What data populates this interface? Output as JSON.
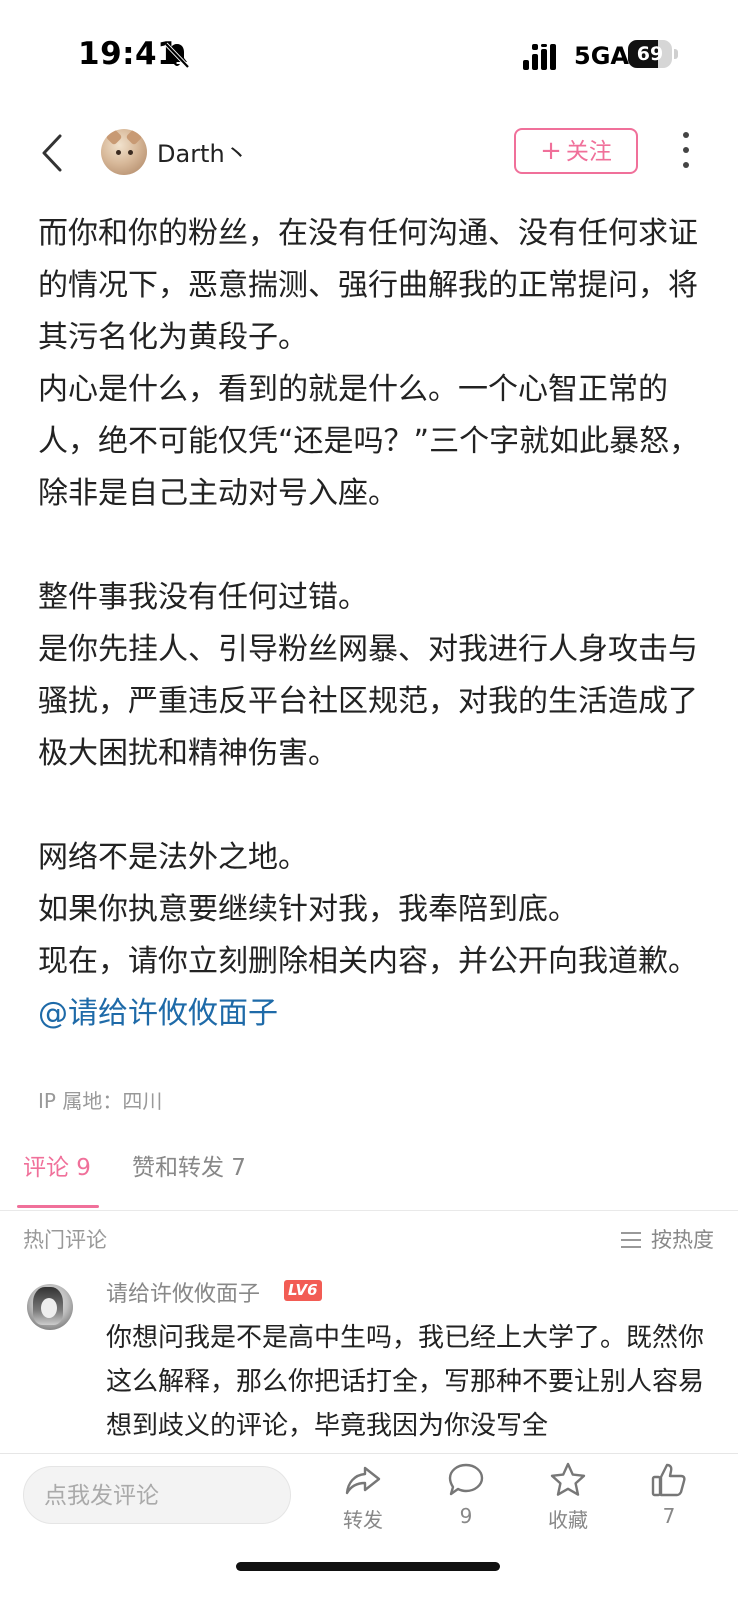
{
  "status_bar": {
    "time": "19:41",
    "network": "5GA",
    "battery": "69",
    "battery_level": 0.69
  },
  "header": {
    "username": "Darth丶",
    "follow_label": "关注",
    "follow_prefix": "+"
  },
  "article": {
    "paragraphs": [
      "而你和你的粉丝，在没有任何沟通、没有任何求证的情况下，恶意揣测、强行曲解我的正常提问，将其污名化为黄段子。",
      "内心是什么，看到的就是什么。一个心智正常的人，绝不可能仅凭“还是吗？”三个字就如此暴怒，除非是自己主动对号入座。",
      "整件事我没有任何过错。",
      "是你先挂人、引导粉丝网暴、对我进行人身攻击与骚扰，严重违反平台社区规范，对我的生活造成了极大困扰和精神伤害。",
      "网络不是法外之地。",
      "如果你执意要继续针对我，我奉陪到底。",
      "现在，请你立刻删除相关内容，并公开向我道歉。"
    ],
    "mention": "@请给许攸攸面子",
    "ip_location": "IP 属地：四川"
  },
  "tabs": {
    "comments": "评论 9",
    "likes_reposts": "赞和转发 7"
  },
  "comments_section": {
    "title": "热门评论",
    "sort_label": "按热度",
    "items": [
      {
        "author": "请给许攸攸面子",
        "level": "LV6",
        "text": "你想问我是不是高中生吗，我已经上大学了。既然你这么解释，那么你把话打全，写那种不要让别人容易想到歧义的评论，毕竟我因为你没写全"
      }
    ]
  },
  "bottom_bar": {
    "input_placeholder": "点我发评论",
    "share_label": "转发",
    "comment_count": "9",
    "favorite_label": "收藏",
    "like_count": "7"
  },
  "colors": {
    "accent": "#f0709a",
    "mention": "#1e6aa8",
    "level_badge": "#f25c54"
  },
  "icons": [
    "mute-bell-icon",
    "signal-icon",
    "battery-icon",
    "back-arrow-icon",
    "more-icon",
    "sort-icon",
    "share-icon",
    "comment-icon",
    "star-icon",
    "thumbs-up-icon"
  ]
}
